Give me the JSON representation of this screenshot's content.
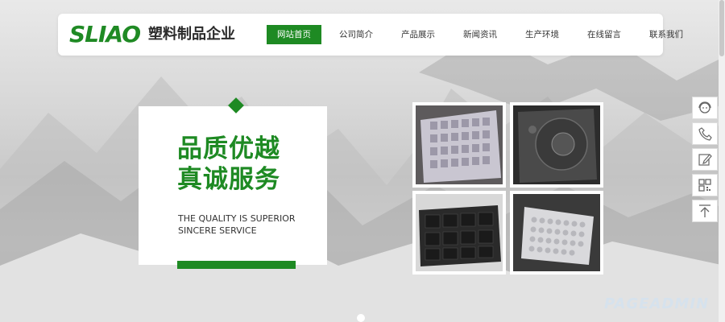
{
  "brand": {
    "mark": "SLIAO",
    "name": "塑料制品企业"
  },
  "nav": {
    "items": [
      {
        "label": "网站首页",
        "active": true
      },
      {
        "label": "公司简介",
        "active": false
      },
      {
        "label": "产品展示",
        "active": false
      },
      {
        "label": "新闻资讯",
        "active": false
      },
      {
        "label": "生产环境",
        "active": false
      },
      {
        "label": "在线留言",
        "active": false
      },
      {
        "label": "联系我们",
        "active": false
      }
    ]
  },
  "hero": {
    "headline_1": "品质优越",
    "headline_2": "真诚服务",
    "sub_1": "THE QUALITY IS SUPERIOR",
    "sub_2": "SINCERE SERVICE"
  },
  "products": [
    {
      "icon": "grid-tray"
    },
    {
      "icon": "round-plate"
    },
    {
      "icon": "black-tray"
    },
    {
      "icon": "white-tray"
    }
  ],
  "sidebar": {
    "items": [
      {
        "icon": "customer-service-icon"
      },
      {
        "icon": "phone-icon"
      },
      {
        "icon": "edit-icon"
      },
      {
        "icon": "qrcode-icon"
      },
      {
        "icon": "back-to-top-icon"
      }
    ]
  },
  "watermark": "PAGEADMIN",
  "colors": {
    "accent": "#1e8a23"
  }
}
